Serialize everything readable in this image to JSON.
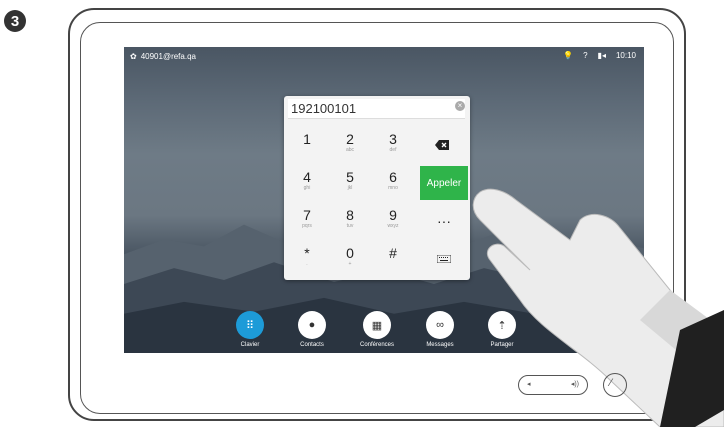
{
  "step": "3",
  "status": {
    "user": "40901@refa.qa",
    "time": "10:10"
  },
  "dialpad": {
    "number": "192100101",
    "keys": [
      {
        "digit": "1",
        "letters": ""
      },
      {
        "digit": "2",
        "letters": "abc"
      },
      {
        "digit": "3",
        "letters": "def"
      },
      {
        "digit": "4",
        "letters": "ghi"
      },
      {
        "digit": "5",
        "letters": "jkl"
      },
      {
        "digit": "6",
        "letters": "mno"
      },
      {
        "digit": "7",
        "letters": "pqrs"
      },
      {
        "digit": "8",
        "letters": "tuv"
      },
      {
        "digit": "9",
        "letters": "wxyz"
      },
      {
        "digit": "*",
        "letters": "."
      },
      {
        "digit": "0",
        "letters": "+"
      },
      {
        "digit": "#",
        "letters": ""
      }
    ],
    "call_label": "Appeler"
  },
  "dock": [
    {
      "label": "Clavier",
      "icon": "keypad-icon"
    },
    {
      "label": "Contacts",
      "icon": "person-icon"
    },
    {
      "label": "Conférences",
      "icon": "calendar-icon"
    },
    {
      "label": "Messages",
      "icon": "voicemail-icon"
    },
    {
      "label": "Partager",
      "icon": "share-icon"
    }
  ],
  "colors": {
    "accent": "#1d9bd8",
    "call": "#2fb44a"
  }
}
